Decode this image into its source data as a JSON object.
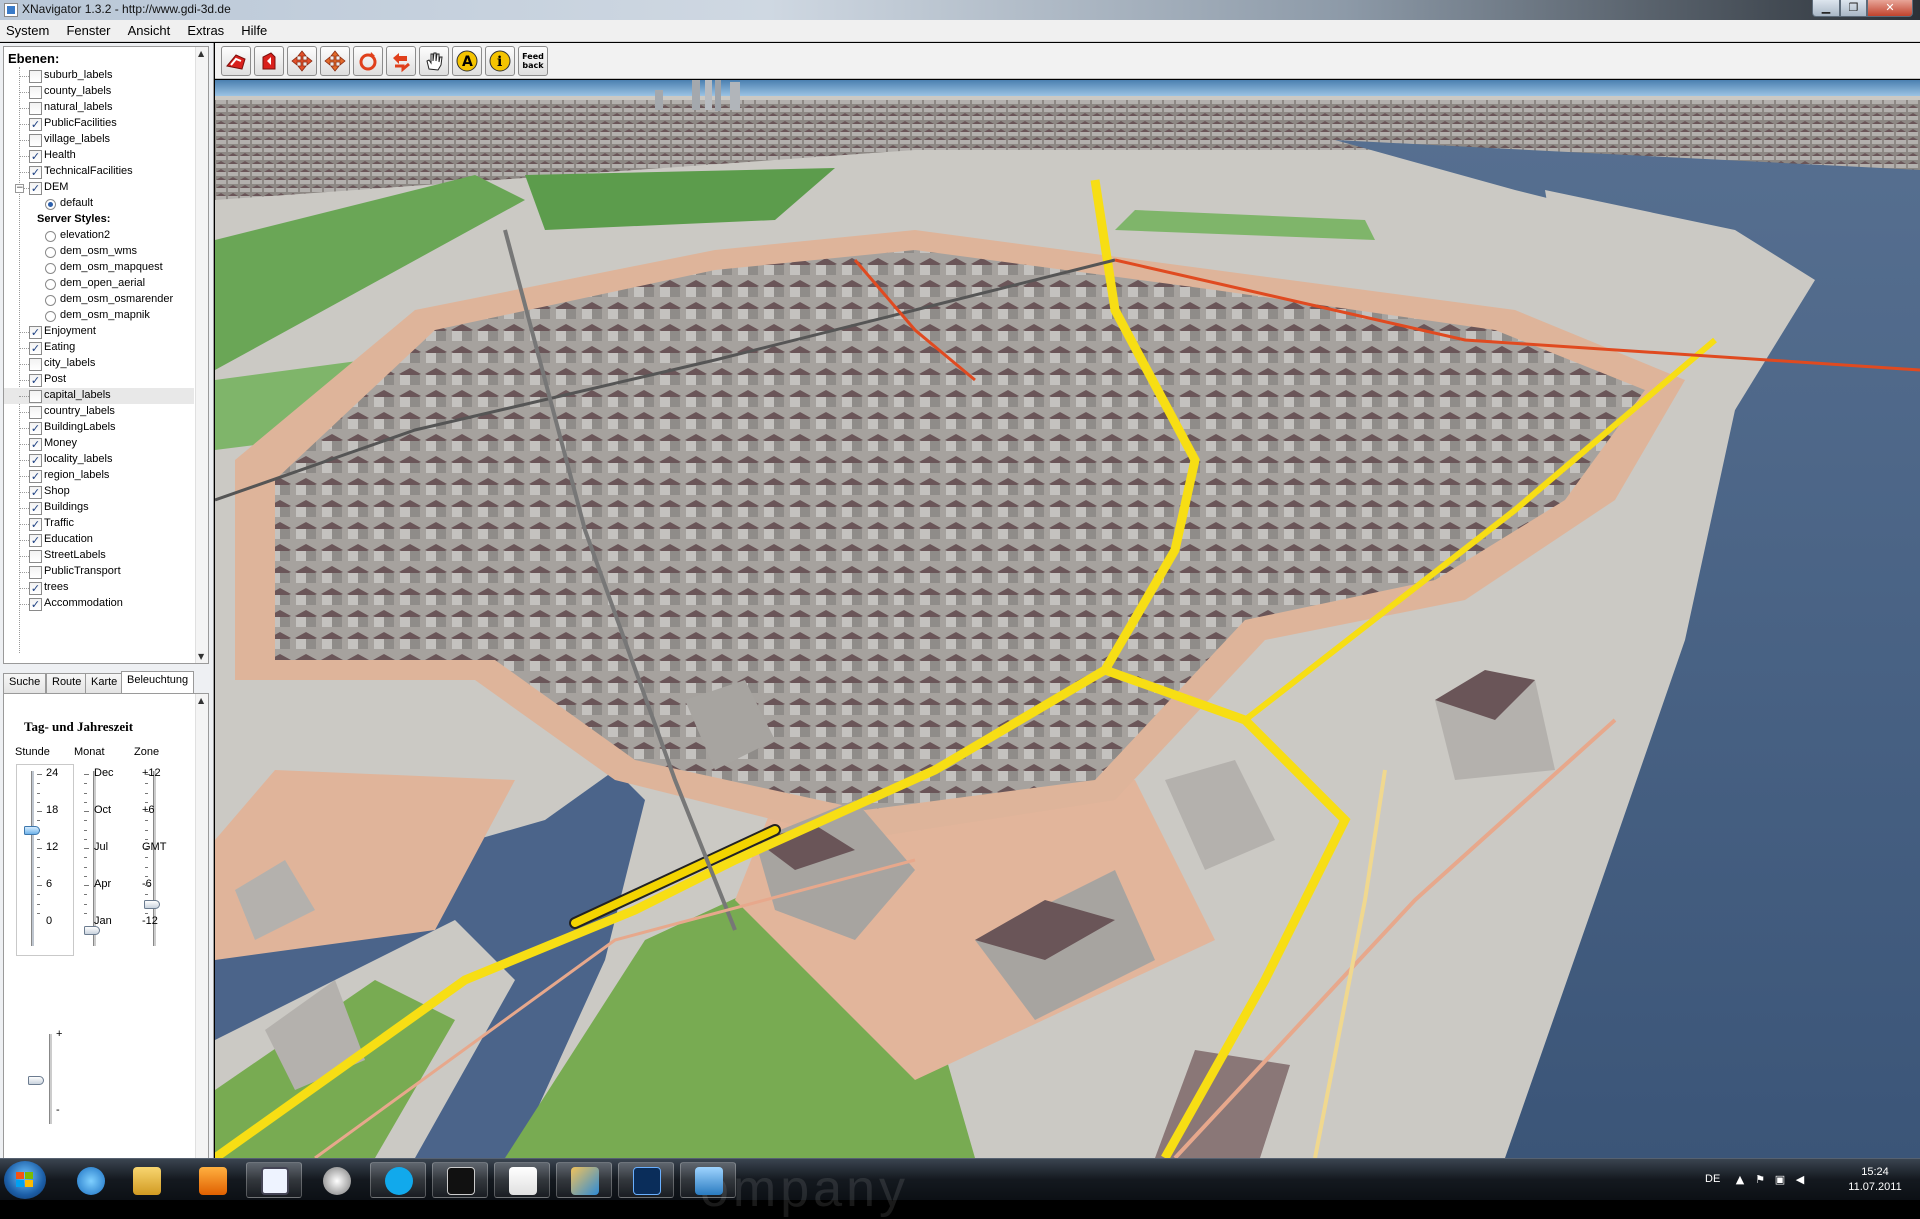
{
  "window": {
    "title": "XNavigator 1.3.2 - http://www.gdi-3d.de"
  },
  "menubar": [
    "System",
    "Fenster",
    "Ansicht",
    "Extras",
    "Hilfe"
  ],
  "layers_panel": {
    "title": "Ebenen:",
    "items": [
      {
        "label": "suburb_labels",
        "checked": false
      },
      {
        "label": "county_labels",
        "checked": false
      },
      {
        "label": "natural_labels",
        "checked": false
      },
      {
        "label": "PublicFacilities",
        "checked": true
      },
      {
        "label": "village_labels",
        "checked": false
      },
      {
        "label": "Health",
        "checked": true
      },
      {
        "label": "TechnicalFacilities",
        "checked": true
      },
      {
        "label": "DEM",
        "checked": true
      },
      {
        "label": "default",
        "radio": true,
        "selected": true
      },
      {
        "label": "Server Styles:",
        "heading": true
      },
      {
        "label": "elevation2",
        "radio": true,
        "selected": false
      },
      {
        "label": "dem_osm_wms",
        "radio": true,
        "selected": false
      },
      {
        "label": "dem_osm_mapquest",
        "radio": true,
        "selected": false
      },
      {
        "label": "dem_open_aerial",
        "radio": true,
        "selected": false
      },
      {
        "label": "dem_osm_osmarender",
        "radio": true,
        "selected": false
      },
      {
        "label": "dem_osm_mapnik",
        "radio": true,
        "selected": false
      },
      {
        "label": "Enjoyment",
        "checked": true
      },
      {
        "label": "Eating",
        "checked": true
      },
      {
        "label": "city_labels",
        "checked": false
      },
      {
        "label": "Post",
        "checked": true
      },
      {
        "label": "capital_labels",
        "checked": false,
        "highlighted": true
      },
      {
        "label": "country_labels",
        "checked": false
      },
      {
        "label": "BuildingLabels",
        "checked": true
      },
      {
        "label": "Money",
        "checked": true
      },
      {
        "label": "locality_labels",
        "checked": true
      },
      {
        "label": "region_labels",
        "checked": true
      },
      {
        "label": "Shop",
        "checked": true
      },
      {
        "label": "Buildings",
        "checked": true
      },
      {
        "label": "Traffic",
        "checked": true
      },
      {
        "label": "Education",
        "checked": true
      },
      {
        "label": "StreetLabels",
        "checked": false
      },
      {
        "label": "PublicTransport",
        "checked": false
      },
      {
        "label": "trees",
        "checked": true
      },
      {
        "label": "Accommodation",
        "checked": true
      }
    ]
  },
  "tabs": [
    {
      "label": "Suche",
      "active": false
    },
    {
      "label": "Route",
      "active": false
    },
    {
      "label": "Karte",
      "active": false
    },
    {
      "label": "Beleuchtung",
      "active": true
    }
  ],
  "lighting": {
    "title": "Tag- und Jahreszeit",
    "col_stunde": "Stunde",
    "col_monat": "Monat",
    "col_zone": "Zone",
    "stunde_ticks": [
      "24",
      "18",
      "12",
      "6",
      "0"
    ],
    "monat_ticks": [
      "Dec",
      "Oct",
      "Jul",
      "Apr",
      "Jan"
    ],
    "zone_ticks": [
      "+12",
      "+6",
      "GMT",
      "-6",
      "-12"
    ],
    "stunde_value": 15,
    "intensity_plus": "+",
    "intensity_minus": "-"
  },
  "toolbar": {
    "buttons": [
      "home-icon",
      "back-icon",
      "move-icon",
      "move-alt-icon",
      "rotate-icon",
      "undo-icon",
      "hand-icon",
      "label-icon",
      "info-icon",
      "feedback-icon"
    ],
    "feedback_label_1": "Feed",
    "feedback_label_2": "back"
  },
  "taskbar": {
    "apps": [
      "explorer-ie-icon",
      "file-explorer-icon",
      "media-player-icon",
      "notepad-icon",
      "vm-icon",
      "skype-icon",
      "cmd-icon",
      "java-icon",
      "paint-icon",
      "photoshop-icon",
      "image-viewer-icon"
    ],
    "wallpaper_text": "ompany",
    "language": "DE",
    "time": "15:24",
    "date": "11.07.2011"
  }
}
